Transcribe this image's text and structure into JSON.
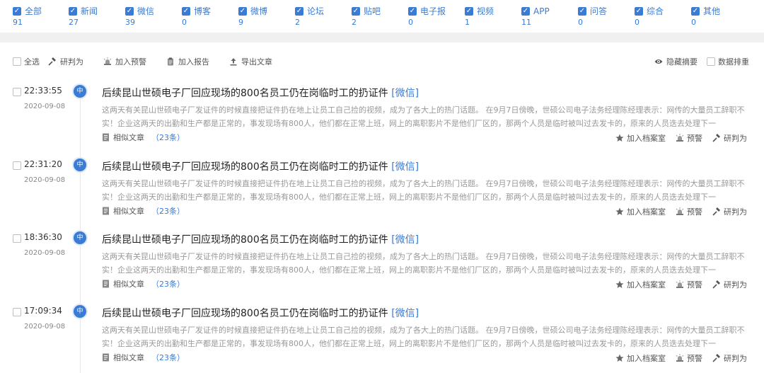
{
  "filters": [
    {
      "label": "全部",
      "count": "91"
    },
    {
      "label": "新闻",
      "count": "27"
    },
    {
      "label": "微信",
      "count": "39"
    },
    {
      "label": "博客",
      "count": "0"
    },
    {
      "label": "微博",
      "count": "9"
    },
    {
      "label": "论坛",
      "count": "2"
    },
    {
      "label": "贴吧",
      "count": "2"
    },
    {
      "label": "电子报",
      "count": "0"
    },
    {
      "label": "视频",
      "count": "1"
    },
    {
      "label": "APP",
      "count": "11"
    },
    {
      "label": "问答",
      "count": "0"
    },
    {
      "label": "综合",
      "count": "0"
    },
    {
      "label": "其他",
      "count": "0"
    }
  ],
  "toolbar": {
    "select_all": "全选",
    "judge": "研判为",
    "add_warning": "加入预警",
    "add_report": "加入报告",
    "export": "导出文章",
    "hide_summary": "隐藏摘要",
    "data_sort": "数据排重"
  },
  "articles": [
    {
      "time": "22:33:55",
      "date": "2020-09-08",
      "badge": "中",
      "title": "后续昆山世硕电子厂回应现场的800名员工仍在岗临时工的扔证件",
      "source": "[微信]",
      "summary": "这两天有关昆山世硕电子厂发证件的时候直接把证件扔在地上让员工自己捡的视频，成为了各大上的热门话题。 在9月7日傍晚，世硕公司电子法务经理陈经理表示：网传的大量员工辞职不实！企业这两天的出勤和生产都是正常的，事发现场有800人，他们都在正常上班，网上的离职影片不是他们厂区的，那两个人员是临时被叫过去发卡的，原来的人员迭去处理下一",
      "similar": "相似文章",
      "similar_count": "（23条）",
      "archive": "加入档案室",
      "warn": "预警",
      "judge": "研判为"
    },
    {
      "time": "22:31:20",
      "date": "2020-09-08",
      "badge": "中",
      "title": "后续昆山世硕电子厂回应现场的800名员工仍在岗临时工的扔证件",
      "source": "[微信]",
      "summary": "这两天有关昆山世硕电子厂发证件的时候直接把证件扔在地上让员工自己捡的视频，成为了各大上的热门话题。 在9月7日傍晚，世硕公司电子法务经理陈经理表示：网传的大量员工辞职不实！企业这两天的出勤和生产都是正常的，事发现场有800人，他们都在正常上班，网上的离职影片不是他们厂区的，那两个人员是临时被叫过去发卡的，原来的人员迭去处理下一",
      "similar": "相似文章",
      "similar_count": "（23条）",
      "archive": "加入档案室",
      "warn": "预警",
      "judge": "研判为"
    },
    {
      "time": "18:36:30",
      "date": "2020-09-08",
      "badge": "中",
      "title": "后续昆山世硕电子厂回应现场的800名员工仍在岗临时工的扔证件",
      "source": "[微信]",
      "summary": "这两天有关昆山世硕电子厂发证件的时候直接把证件扔在地上让员工自己捡的视频，成为了各大上的热门话题。 在9月7日傍晚，世硕公司电子法务经理陈经理表示：网传的大量员工辞职不实！企业这两天的出勤和生产都是正常的，事发现场有800人，他们都在正常上班，网上的离职影片不是他们厂区的，那两个人员是临时被叫过去发卡的，原来的人员迭去处理下一",
      "similar": "相似文章",
      "similar_count": "（23条）",
      "archive": "加入档案室",
      "warn": "预警",
      "judge": "研判为"
    },
    {
      "time": "17:09:34",
      "date": "2020-09-08",
      "badge": "中",
      "title": "后续昆山世硕电子厂回应现场的800名员工仍在岗临时工的扔证件",
      "source": "[微信]",
      "summary": "这两天有关昆山世硕电子厂发证件的时候直接把证件扔在地上让员工自己捡的视频，成为了各大上的热门话题。 在9月7日傍晚，世硕公司电子法务经理陈经理表示：网传的大量员工辞职不实！企业这两天的出勤和生产都是正常的，事发现场有800人，他们都在正常上班，网上的离职影片不是他们厂区的，那两个人员是临时被叫过去发卡的，原来的人员迭去处理下一",
      "similar": "相似文章",
      "similar_count": "（23条）",
      "archive": "加入档案室",
      "warn": "预警",
      "judge": "研判为"
    }
  ],
  "colors": {
    "accent": "#3a7bd5",
    "muted_text": "#999999",
    "band": "#f0f0f0"
  }
}
